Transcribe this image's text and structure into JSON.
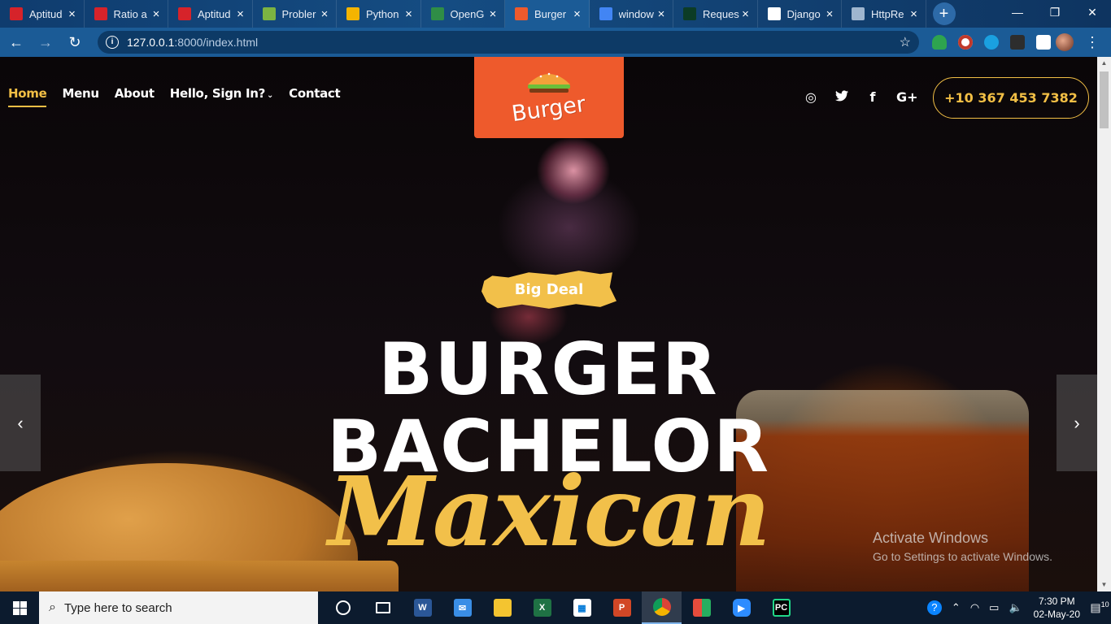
{
  "browser": {
    "tabs": [
      {
        "title": "Aptitud",
        "icon": "indiabix-icon",
        "color": "#d6232a"
      },
      {
        "title": "Ratio a",
        "icon": "indiabix-icon",
        "color": "#d6232a"
      },
      {
        "title": "Aptitud",
        "icon": "indiabix-icon",
        "color": "#d6232a"
      },
      {
        "title": "Probler",
        "icon": "hackerrank-icon",
        "color": "#7cb342"
      },
      {
        "title": "Python",
        "icon": "colab-icon",
        "color": "#f4b400"
      },
      {
        "title": "OpenG",
        "icon": "geeksforgeeks-icon",
        "color": "#2f8d46"
      },
      {
        "title": "Burger",
        "icon": "burger-favicon",
        "color": "#ee5a2c"
      },
      {
        "title": "window",
        "icon": "google-icon",
        "color": "#4285f4"
      },
      {
        "title": "Reques",
        "icon": "django-icon",
        "color": "#0c3c26"
      },
      {
        "title": "Django",
        "icon": "page-icon",
        "color": "#ffffff"
      },
      {
        "title": "HttpRe",
        "icon": "globe-icon",
        "color": "#9fb6cf"
      }
    ],
    "active_tab": 6,
    "url_host": "127.0.0.1",
    "url_path": ":8000/index.html"
  },
  "site": {
    "nav": [
      "Home",
      "Menu",
      "About",
      "Hello, Sign In?",
      "Contact"
    ],
    "logo_text": "Burger",
    "social": [
      "instagram-icon",
      "twitter-icon",
      "facebook-icon",
      "google-plus-icon"
    ],
    "social_glyphs": [
      "◎",
      "🐦",
      "f",
      "G+"
    ],
    "phone": "+10 367 453 7382",
    "badge": "Big Deal",
    "headline_1": "BURGER",
    "headline_2": "BACHELOR",
    "script": "Maxican",
    "accent": "#f2c04a",
    "logo_bg": "#ee5a2c"
  },
  "watermark": {
    "title": "Activate Windows",
    "subtitle": "Go to Settings to activate Windows."
  },
  "taskbar": {
    "search_placeholder": "Type here to search",
    "time": "7:30 PM",
    "date": "02-May-20",
    "notification_count": "10"
  }
}
